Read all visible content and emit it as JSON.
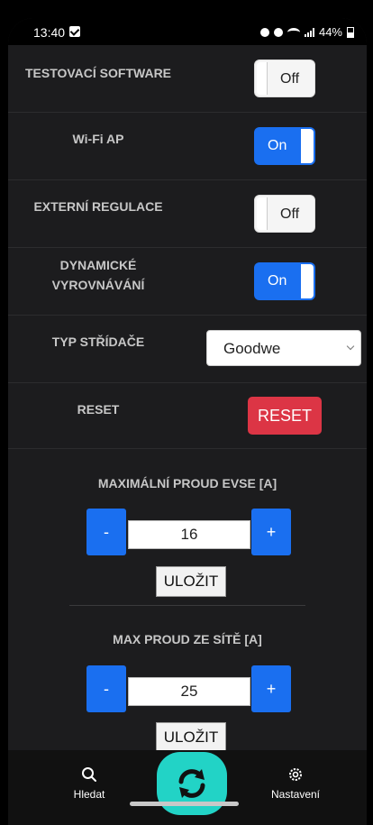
{
  "status_bar": {
    "time": "13:40",
    "battery": "44%"
  },
  "settings": {
    "testing_software": {
      "label": "TESTOVACÍ SOFTWARE",
      "state": "Off"
    },
    "wifi_ap": {
      "label": "Wi-Fi AP",
      "state": "On"
    },
    "external_regulation": {
      "label": "EXTERNÍ REGULACE",
      "state": "Off"
    },
    "dynamic_balancing": {
      "label_line1": "DYNAMICKÉ",
      "label_line2": "VYROVNÁVÁNÍ",
      "state": "On"
    },
    "inverter_type": {
      "label": "TYP STŘÍDAČE",
      "selected": "Goodwe"
    },
    "reset": {
      "label": "RESET",
      "button": "RESET"
    }
  },
  "max_current_evse": {
    "title": "MAXIMÁLNÍ PROUD EVSE [A]",
    "minus": "-",
    "plus": "+",
    "value": "16",
    "save": "ULOŽIT"
  },
  "max_current_grid": {
    "title": "MAX PROUD ZE SÍTĚ [A]",
    "minus": "-",
    "plus": "+",
    "value": "25",
    "save": "ULOŽIT"
  },
  "bottom_nav": {
    "search": "Hledat",
    "settings": "Nastavení",
    "accent_color": "#22d3c6"
  }
}
